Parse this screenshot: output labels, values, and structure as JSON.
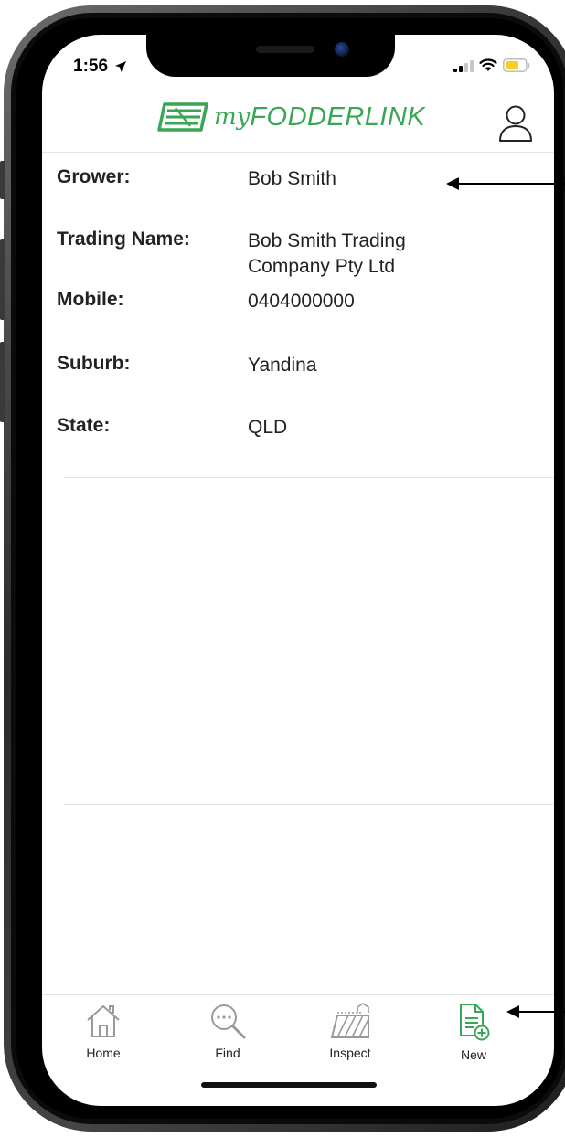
{
  "status_bar": {
    "time": "1:56"
  },
  "header": {
    "logo_prefix": "my",
    "logo_text": "FODDERLINK"
  },
  "details": {
    "grower_label": "Grower:",
    "grower_value": "Bob Smith",
    "trading_label": "Trading Name:",
    "trading_value_line1": "Bob Smith Trading",
    "trading_value_line2": "Company Pty Ltd",
    "mobile_label": "Mobile:",
    "mobile_value": "0404000000",
    "suburb_label": "Suburb:",
    "suburb_value": "Yandina",
    "state_label": "State:",
    "state_value": "QLD"
  },
  "tabbar": {
    "items": [
      {
        "label": "Home",
        "icon": "home-icon"
      },
      {
        "label": "Find",
        "icon": "search-icon"
      },
      {
        "label": "Inspect",
        "icon": "field-icon"
      },
      {
        "label": "New",
        "icon": "new-document-icon"
      }
    ],
    "active": "New"
  },
  "colors": {
    "brand_green": "#3aa655",
    "battery_yellow": "#f5d020"
  }
}
